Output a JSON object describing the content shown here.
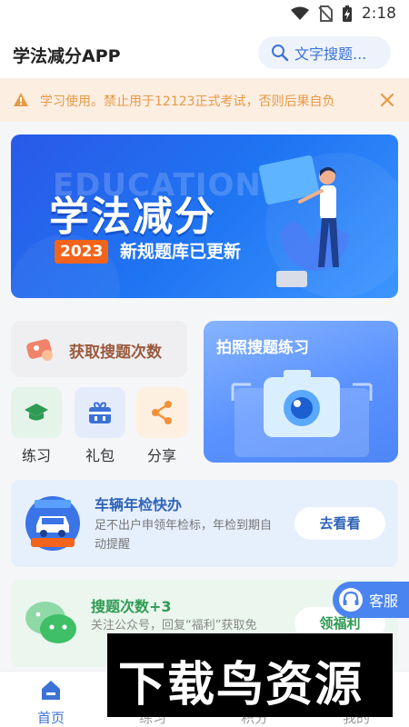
{
  "status_bar": {
    "time": "2:18"
  },
  "app": {
    "title": "学法减分APP"
  },
  "search": {
    "label": "文字搜题..."
  },
  "notice": {
    "text": "学习使用。禁止用于12123正式考试，否则后果自负"
  },
  "banner": {
    "watermark_word": "EDUCATION",
    "title": "学法减分",
    "year": "2023",
    "subtitle": "新规题库已更新"
  },
  "features": {
    "get_count_label": "获取搜题次数",
    "photo_search_label": "拍照搜题练习",
    "items": [
      {
        "label": "练习",
        "icon": "graduation-cap-icon"
      },
      {
        "label": "礼包",
        "icon": "gift-box-icon"
      },
      {
        "label": "分享",
        "icon": "share-icon"
      }
    ]
  },
  "inspection": {
    "title": "车辆年检快办",
    "description": "足不出户申领年检标，年检到期自动提醒",
    "button": "去看看",
    "badge_top": "年检申领",
    "badge_bottom": "车辆年检"
  },
  "welfare": {
    "title": "搜题次数+3",
    "description": "关注公众号，回复“福利”获取免",
    "button": "领福利"
  },
  "customer_service": {
    "label": "客服"
  },
  "tabs": [
    {
      "label": "首页",
      "active": true
    },
    {
      "label": "练习",
      "active": false
    },
    {
      "label": "积分",
      "active": false
    },
    {
      "label": "我的",
      "active": false
    }
  ],
  "watermark": {
    "text": "下载鸟资源"
  },
  "colors": {
    "primary": "#3c72d6",
    "notice_text": "#e59a45",
    "green": "#2e9b53",
    "orange_badge": "#f2641c"
  }
}
